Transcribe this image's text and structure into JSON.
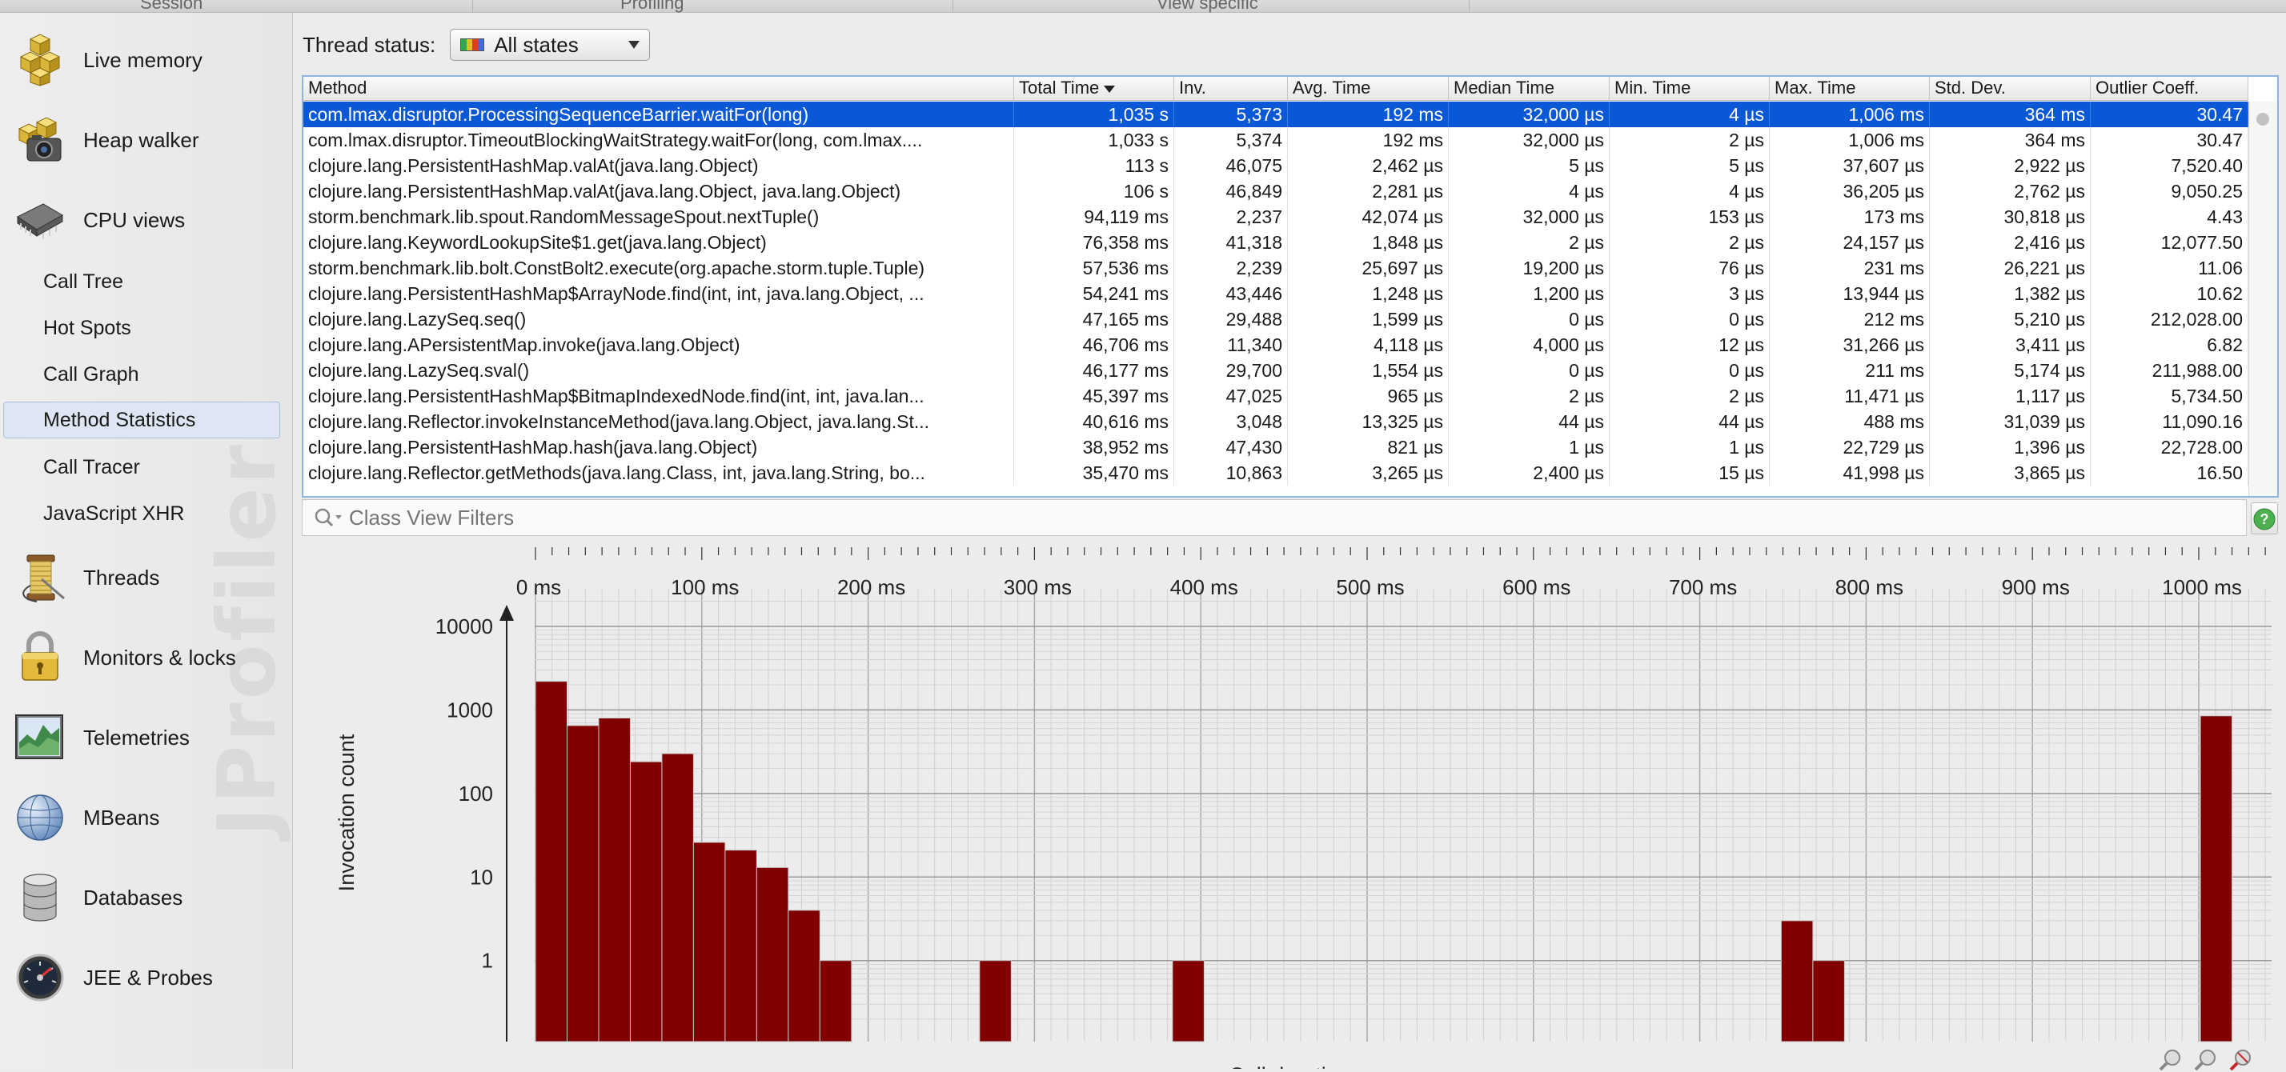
{
  "topbar": {
    "tabs": [
      "Session",
      "Profiling",
      "View specific"
    ]
  },
  "sidebar": {
    "watermark": "JProfiler",
    "sections": [
      {
        "label": "Live memory",
        "icon": "cubes-icon"
      },
      {
        "label": "Heap walker",
        "icon": "camera-cubes-icon"
      },
      {
        "label": "CPU views",
        "icon": "cpu-chip-icon"
      },
      {
        "label": "Threads",
        "icon": "thread-spool-icon"
      },
      {
        "label": "Monitors & locks",
        "icon": "padlock-icon"
      },
      {
        "label": "Telemetries",
        "icon": "telemetry-chart-icon"
      },
      {
        "label": "MBeans",
        "icon": "globe-icon"
      },
      {
        "label": "Databases",
        "icon": "database-icon"
      },
      {
        "label": "JEE & Probes",
        "icon": "gauge-icon"
      }
    ],
    "cpu_items": [
      {
        "label": "Call Tree",
        "selected": false
      },
      {
        "label": "Hot Spots",
        "selected": false
      },
      {
        "label": "Call Graph",
        "selected": false
      },
      {
        "label": "Method Statistics",
        "selected": true
      },
      {
        "label": "Call Tracer",
        "selected": false
      },
      {
        "label": "JavaScript XHR",
        "selected": false
      }
    ]
  },
  "thread_status": {
    "label": "Thread status:",
    "value": "All states"
  },
  "table": {
    "columns": [
      "Method",
      "Total Time",
      "Inv.",
      "Avg. Time",
      "Median Time",
      "Min. Time",
      "Max. Time",
      "Std. Dev.",
      "Outlier Coeff."
    ],
    "sort_column": "Total Time",
    "rows": [
      [
        "com.lmax.disruptor.ProcessingSequenceBarrier.waitFor(long)",
        "1,035 s",
        "5,373",
        "192 ms",
        "32,000 µs",
        "4 µs",
        "1,006 ms",
        "364 ms",
        "30.47"
      ],
      [
        "com.lmax.disruptor.TimeoutBlockingWaitStrategy.waitFor(long, com.lmax....",
        "1,033 s",
        "5,374",
        "192 ms",
        "32,000 µs",
        "2 µs",
        "1,006 ms",
        "364 ms",
        "30.47"
      ],
      [
        "clojure.lang.PersistentHashMap.valAt(java.lang.Object)",
        "113 s",
        "46,075",
        "2,462 µs",
        "5 µs",
        "5 µs",
        "37,607 µs",
        "2,922 µs",
        "7,520.40"
      ],
      [
        "clojure.lang.PersistentHashMap.valAt(java.lang.Object, java.lang.Object)",
        "106 s",
        "46,849",
        "2,281 µs",
        "4 µs",
        "4 µs",
        "36,205 µs",
        "2,762 µs",
        "9,050.25"
      ],
      [
        "storm.benchmark.lib.spout.RandomMessageSpout.nextTuple()",
        "94,119 ms",
        "2,237",
        "42,074 µs",
        "32,000 µs",
        "153 µs",
        "173 ms",
        "30,818 µs",
        "4.43"
      ],
      [
        "clojure.lang.KeywordLookupSite$1.get(java.lang.Object)",
        "76,358 ms",
        "41,318",
        "1,848 µs",
        "2 µs",
        "2 µs",
        "24,157 µs",
        "2,416 µs",
        "12,077.50"
      ],
      [
        "storm.benchmark.lib.bolt.ConstBolt2.execute(org.apache.storm.tuple.Tuple)",
        "57,536 ms",
        "2,239",
        "25,697 µs",
        "19,200 µs",
        "76 µs",
        "231 ms",
        "26,221 µs",
        "11.06"
      ],
      [
        "clojure.lang.PersistentHashMap$ArrayNode.find(int, int, java.lang.Object, ...",
        "54,241 ms",
        "43,446",
        "1,248 µs",
        "1,200 µs",
        "3 µs",
        "13,944 µs",
        "1,382 µs",
        "10.62"
      ],
      [
        "clojure.lang.LazySeq.seq()",
        "47,165 ms",
        "29,488",
        "1,599 µs",
        "0 µs",
        "0 µs",
        "212 ms",
        "5,210 µs",
        "212,028.00"
      ],
      [
        "clojure.lang.APersistentMap.invoke(java.lang.Object)",
        "46,706 ms",
        "11,340",
        "4,118 µs",
        "4,000 µs",
        "12 µs",
        "31,266 µs",
        "3,411 µs",
        "6.82"
      ],
      [
        "clojure.lang.LazySeq.sval()",
        "46,177 ms",
        "29,700",
        "1,554 µs",
        "0 µs",
        "0 µs",
        "211 ms",
        "5,174 µs",
        "211,988.00"
      ],
      [
        "clojure.lang.PersistentHashMap$BitmapIndexedNode.find(int, int, java.lan...",
        "45,397 ms",
        "47,025",
        "965 µs",
        "2 µs",
        "2 µs",
        "11,471 µs",
        "1,117 µs",
        "5,734.50"
      ],
      [
        "clojure.lang.Reflector.invokeInstanceMethod(java.lang.Object, java.lang.St...",
        "40,616 ms",
        "3,048",
        "13,325 µs",
        "44 µs",
        "44 µs",
        "488 ms",
        "31,039 µs",
        "11,090.16"
      ],
      [
        "clojure.lang.PersistentHashMap.hash(java.lang.Object)",
        "38,952 ms",
        "47,430",
        "821 µs",
        "1 µs",
        "1 µs",
        "22,729 µs",
        "1,396 µs",
        "22,728.00"
      ],
      [
        "clojure.lang.Reflector.getMethods(java.lang.Class, int, java.lang.String, bo...",
        "35,470 ms",
        "10,863",
        "3,265 µs",
        "2,400 µs",
        "15 µs",
        "41,998 µs",
        "3,865 µs",
        "16.50"
      ]
    ],
    "selected_row": 0
  },
  "filter": {
    "placeholder": "Class View Filters"
  },
  "colors": {
    "selection": "#0b58d6",
    "bar": "#800000",
    "accent": "#8fb5dc"
  },
  "chart_data": {
    "type": "bar",
    "xlabel": "Call duration",
    "ylabel": "Invocation count",
    "xlim": [
      0,
      1050
    ],
    "x_ticks": [
      0,
      100,
      200,
      300,
      400,
      500,
      600,
      700,
      800,
      900,
      1000
    ],
    "x_tick_labels": [
      "0 ms",
      "100 ms",
      "200 ms",
      "300 ms",
      "400 ms",
      "500 ms",
      "600 ms",
      "700 ms",
      "800 ms",
      "900 ms",
      "1000 ms"
    ],
    "y_scale": "log",
    "y_ticks": [
      1,
      10,
      100,
      1000,
      10000
    ],
    "y_tick_labels": [
      "1",
      "10",
      "100",
      "1000",
      "10000"
    ],
    "grid": true,
    "bins": [
      {
        "start": 0,
        "end": 19,
        "count": 2200
      },
      {
        "start": 19,
        "end": 38,
        "count": 650
      },
      {
        "start": 38,
        "end": 57,
        "count": 800
      },
      {
        "start": 57,
        "end": 76,
        "count": 240
      },
      {
        "start": 76,
        "end": 95,
        "count": 300
      },
      {
        "start": 95,
        "end": 114,
        "count": 26
      },
      {
        "start": 114,
        "end": 133,
        "count": 21
      },
      {
        "start": 133,
        "end": 152,
        "count": 13
      },
      {
        "start": 152,
        "end": 171,
        "count": 4
      },
      {
        "start": 171,
        "end": 190,
        "count": 1
      },
      {
        "start": 267,
        "end": 286,
        "count": 1
      },
      {
        "start": 383,
        "end": 402,
        "count": 1
      },
      {
        "start": 749,
        "end": 768,
        "count": 3
      },
      {
        "start": 768,
        "end": 787,
        "count": 1
      },
      {
        "start": 1001,
        "end": 1020,
        "count": 850
      }
    ]
  }
}
